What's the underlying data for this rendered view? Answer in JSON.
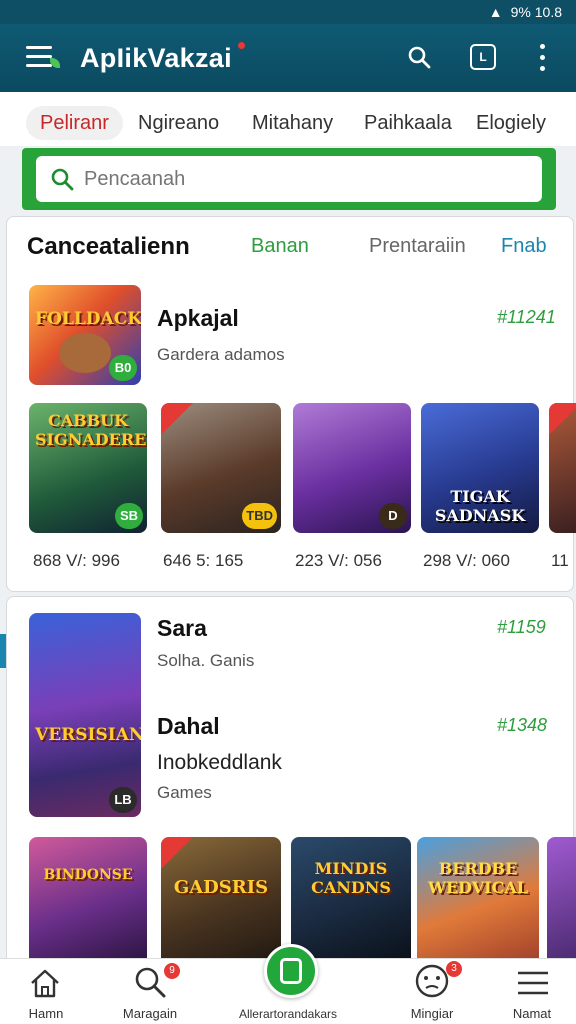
{
  "status": {
    "text": "9% 10.8"
  },
  "appbar": {
    "title": "ApIikVakzai",
    "box_label": "L"
  },
  "tabs": [
    {
      "label": "Peliranr"
    },
    {
      "label": "Ngireano"
    },
    {
      "label": "Mitahany"
    },
    {
      "label": "Paihkaala"
    },
    {
      "label": "Elogiely"
    }
  ],
  "search": {
    "placeholder": "Pencaanah"
  },
  "section1": {
    "title": "Canceatalienn",
    "filters": [
      "Banan",
      "Prentaraiin",
      "Fnab"
    ],
    "featured": {
      "name": "Apkajal",
      "sub": "Gardera adamos",
      "price": "#11241",
      "thumb_label": "FOLLDACK",
      "badge": "B0"
    },
    "thumbs": [
      {
        "label": "CABBUK SIGNADERE",
        "badge": "SB",
        "caption": "868 V/: 996"
      },
      {
        "label": "",
        "badge": "TBD",
        "caption": "646 5: 165"
      },
      {
        "label": "",
        "badge": "D",
        "caption": "223 V/: 056"
      },
      {
        "label": "TIGAK SADNASK",
        "badge": "",
        "caption": "298 V/: 060"
      },
      {
        "label": "",
        "badge": "",
        "caption": "11"
      }
    ]
  },
  "section2": {
    "item1": {
      "name": "Sara",
      "sub": "Solha. Ganis",
      "price": "#1159"
    },
    "item2": {
      "name": "Dahal",
      "sub": "Inobkeddlank",
      "sub2": "Games",
      "price": "#1348",
      "thumb_label": "VERSISIAN",
      "badge": "LB"
    },
    "thumbs": [
      {
        "label": "BINDONSE"
      },
      {
        "label": "GADSRIS"
      },
      {
        "label": "MINDIS CANDNS"
      },
      {
        "label": "BERDBE WEDVICAL"
      },
      {
        "label": ""
      }
    ]
  },
  "bottomnav": {
    "home": "Hamn",
    "search": "Maragain",
    "center": "Allerartorandakars",
    "profile": "Mingiar",
    "menu": "Namat",
    "search_badge": "9",
    "profile_badge": "3"
  }
}
